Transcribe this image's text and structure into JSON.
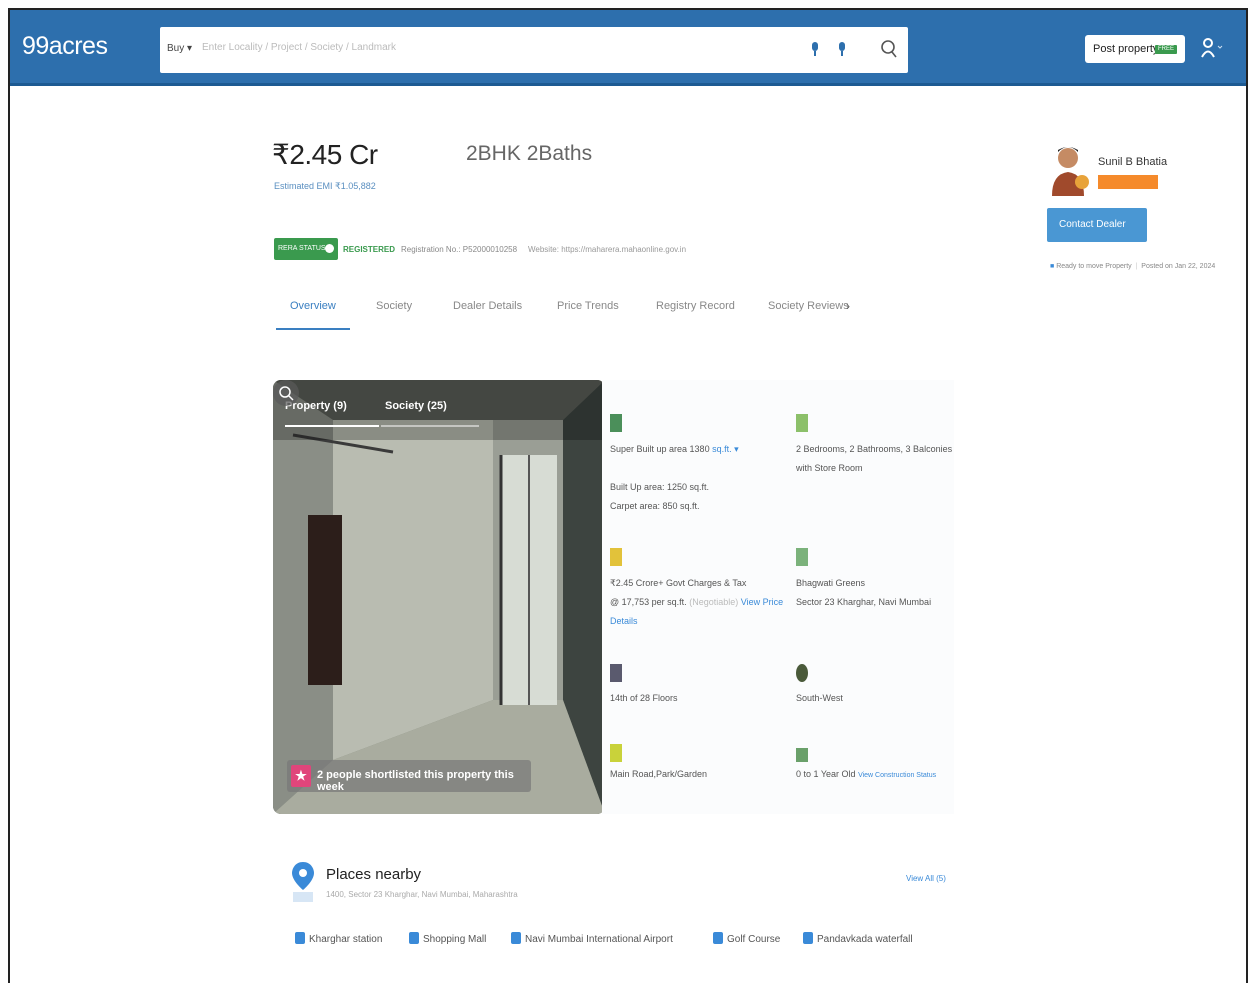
{
  "header": {
    "logo": "99acres",
    "search_type": "Buy",
    "search_placeholder": "Enter Locality / Project / Society / Landmark",
    "post_property_label": "Post property",
    "post_property_tag": "FREE"
  },
  "listing": {
    "price": "₹2.45 Cr",
    "config": "2BHK 2Baths",
    "emi": "Estimated EMI ₹1.05,882",
    "rera_badge": "RERA STATUS",
    "rera_status": "REGISTERED",
    "rera_registration": "Registration No.: P52000010258",
    "rera_website": "Website: https://maharera.mahaonline.gov.in"
  },
  "tabs": [
    {
      "label": "Overview"
    },
    {
      "label": "Society"
    },
    {
      "label": "Dealer Details"
    },
    {
      "label": "Price Trends"
    },
    {
      "label": "Registry Record"
    },
    {
      "label": "Society Reviews"
    }
  ],
  "dealer": {
    "name": "Sunil B Bhatia",
    "contact_button": "Contact Dealer",
    "ready_status": "Ready to move Property",
    "posted": "Posted on Jan 22, 2024"
  },
  "gallery": {
    "tab_property": "Property (9)",
    "tab_society": "Society (25)",
    "shortlist_text": "2 people shortlisted this property this week"
  },
  "specs": {
    "area": {
      "super": "Super Built up area 1380",
      "super_unit": "sq.ft.",
      "built": "Built Up area: 1250 sq.ft.",
      "carpet": "Carpet area: 850 sq.ft."
    },
    "configuration": {
      "line1": "2 Bedrooms, 2 Bathrooms, 3 Balconies",
      "line2": "with Store Room"
    },
    "price": {
      "line1": "₹2.45 Crore+ Govt Charges & Tax",
      "line2": "@ 17,753 per sq.ft.",
      "negotiable": "(Negotiable)",
      "view_link": "View Price",
      "details_link": "Details"
    },
    "address": {
      "line1": "Bhagwati Greens",
      "line2": "Sector 23 Kharghar, Navi Mumbai"
    },
    "floor": {
      "value": "14th of 28 Floors"
    },
    "facing": {
      "value": "South-West"
    },
    "overlooking": {
      "value": "Main Road,Park/Garden"
    },
    "property_age": {
      "value": "0 to 1 Year Old",
      "link": "View Construction Status"
    }
  },
  "places": {
    "title": "Places nearby",
    "address": "1400, Sector 23 Kharghar, Navi Mumbai, Maharashtra",
    "view_all": "View All (5)",
    "items": [
      {
        "label": "Kharghar station"
      },
      {
        "label": "Shopping Mall"
      },
      {
        "label": "Navi Mumbai International Airport"
      },
      {
        "label": "Golf Course"
      },
      {
        "label": "Pandavkada waterfall"
      }
    ]
  }
}
